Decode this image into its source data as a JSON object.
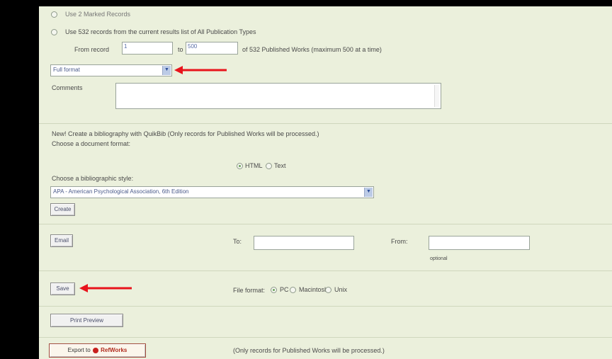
{
  "records": {
    "marked_option": "Use 2 Marked Records",
    "all_option": "Use 532 records from the current results list of All Publication Types",
    "from_label": "From record",
    "from_value": "1",
    "to_label": "to",
    "to_value": "500",
    "range_suffix": "of 532 Published Works (maximum 500 at a time)"
  },
  "format_select": {
    "value": "Full format"
  },
  "comments": {
    "label": "Comments"
  },
  "quikbib": {
    "intro": "New! Create a bibliography with QuikBib (Only records for Published Works will be processed.)",
    "doc_format_label": "Choose a document format:",
    "html_label": "HTML",
    "text_label": "Text",
    "style_label": "Choose a bibliographic style:",
    "style_value": "APA - American Psychological Association, 6th Edition",
    "create_label": "Create"
  },
  "email": {
    "button_label": "Email",
    "to_label": "To:",
    "from_label": "From:",
    "optional_note": "optional"
  },
  "save": {
    "button_label": "Save",
    "file_format_label": "File format:",
    "pc_label": "PC",
    "mac_label": "Macintosh",
    "unix_label": "Unix"
  },
  "print": {
    "button_label": "Print Preview"
  },
  "refworks": {
    "button_prefix": "Export to",
    "button_brand": "RefWorks",
    "note": "(Only records for Published Works will be processed.)"
  },
  "colors": {
    "annotation_arrow": "#e8141c",
    "panel_background": "#ebf0dc"
  }
}
